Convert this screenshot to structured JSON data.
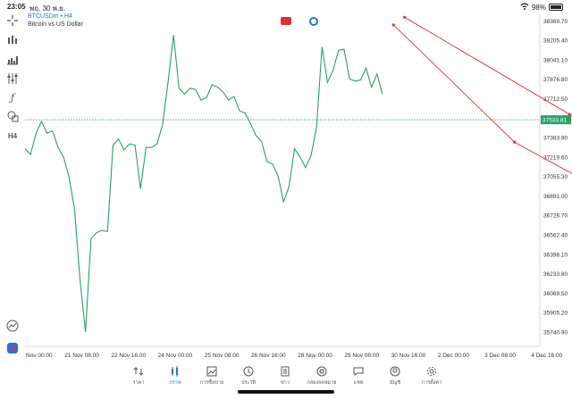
{
  "status": {
    "time": "23:05",
    "date": "พฤ. 30 พ.ย.",
    "battery": "98%"
  },
  "symbol": {
    "name": "BTCUSDm • H4",
    "description": "Bitcoin vs US Dollar"
  },
  "toolbar": {
    "items": [
      {
        "name": "crosshair-icon",
        "glyph": "+"
      },
      {
        "name": "indicator-icon",
        "glyph": "⫶"
      },
      {
        "name": "bar-chart-icon",
        "glyph": "▥"
      },
      {
        "name": "settings-sliders-icon",
        "glyph": "☰"
      },
      {
        "name": "function-icon",
        "glyph": "ƒ"
      },
      {
        "name": "objects-icon",
        "glyph": "⬠"
      },
      {
        "name": "timeframe-label",
        "glyph": "H4"
      }
    ]
  },
  "chart_data": {
    "type": "line",
    "current_price_label": "37533.81",
    "current_price": 37533.81,
    "y_ticks": [
      "38369.70",
      "38205.40",
      "38041.10",
      "37876.80",
      "37712.50",
      "37383.90",
      "37219.60",
      "37055.30",
      "36891.00",
      "36726.70",
      "36562.40",
      "36398.10",
      "36233.80",
      "36069.50",
      "35905.20",
      "35740.90"
    ],
    "ylim": [
      35620,
      38440
    ],
    "x_labels": [
      "20 Nov 00:00",
      "21 Nov 08:00",
      "22 Nov 16:00",
      "24 Nov 00:00",
      "25 Nov 08:00",
      "26 Nov 16:00",
      "28 Nov 00:00",
      "29 Nov 08:00",
      "30 Nov 16:00",
      "2 Dec 00:00",
      "3 Dec 08:00",
      "4 Dec 16:00"
    ],
    "series": [
      {
        "color": "#26a269",
        "values": [
          37290,
          37240,
          37420,
          37520,
          37420,
          37440,
          37300,
          37220,
          37050,
          36780,
          36180,
          35740,
          36530,
          36580,
          36600,
          36590,
          37320,
          37370,
          37280,
          37330,
          37320,
          36950,
          37300,
          37300,
          37330,
          37490,
          37850,
          38250,
          37800,
          37750,
          37800,
          37790,
          37700,
          37720,
          37830,
          37810,
          37770,
          37700,
          37730,
          37610,
          37590,
          37500,
          37400,
          37350,
          37180,
          37160,
          37060,
          36840,
          36970,
          37290,
          37220,
          37130,
          37230,
          37470,
          38150,
          37850,
          37950,
          38120,
          38130,
          37880,
          37860,
          37870,
          37970,
          37810,
          37920,
          37750
        ]
      }
    ],
    "trend_lines": [
      {
        "color": "#e03131",
        "points": [
          [
            67,
            38335
          ],
          [
            89,
            37345
          ],
          [
            121,
            36530
          ]
        ]
      },
      {
        "color": "#e03131",
        "points": [
          [
            69,
            38400
          ],
          [
            99,
            37580
          ],
          [
            122,
            36590
          ]
        ]
      }
    ]
  },
  "nav": {
    "items": [
      {
        "label": "ราคา",
        "name": "nav-quotes",
        "icon": "quotes-icon"
      },
      {
        "label": "กราฟ",
        "name": "nav-chart",
        "icon": "chart-icon",
        "active": true
      },
      {
        "label": "การซื้อขาย",
        "name": "nav-trade",
        "icon": "trade-icon"
      },
      {
        "label": "ประวัติ",
        "name": "nav-history",
        "icon": "history-icon"
      },
      {
        "label": "ข่าว",
        "name": "nav-news",
        "icon": "news-icon"
      },
      {
        "label": "กล่องจดหมาย",
        "name": "nav-mailbox",
        "icon": "mail-icon"
      },
      {
        "label": "แชท",
        "name": "nav-chat",
        "icon": "chat-icon"
      },
      {
        "label": "บัญชี",
        "name": "nav-account",
        "icon": "account-icon"
      },
      {
        "label": "การตั้งค่า",
        "name": "nav-settings",
        "icon": "settings-icon"
      }
    ]
  },
  "colors": {
    "accent": "#2a6fdb",
    "line": "#26a269",
    "trend": "#e03131"
  }
}
